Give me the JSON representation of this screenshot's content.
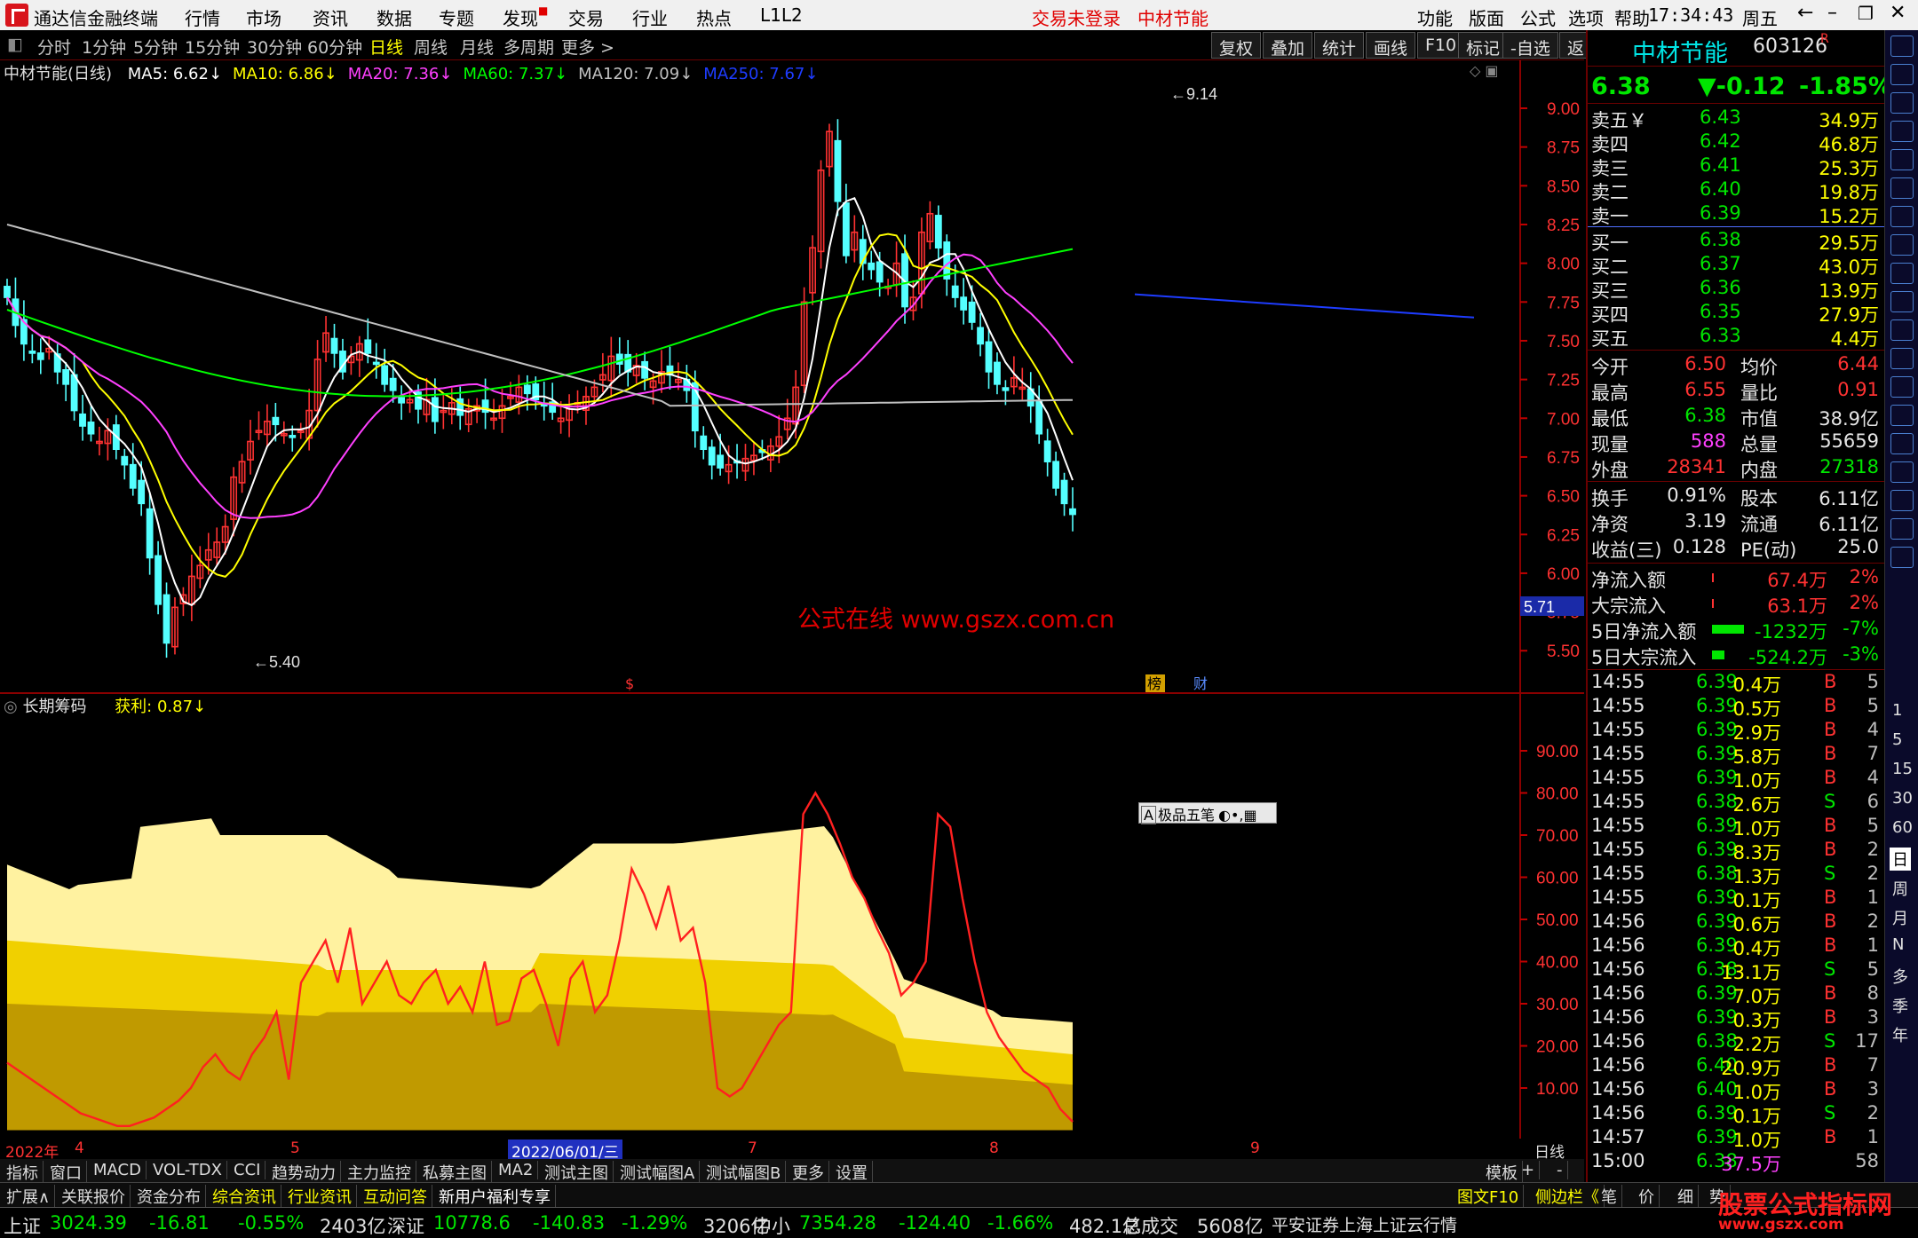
{
  "titlebar": {
    "app_name": "通达信金融终端",
    "menu": [
      "行情",
      "市场",
      "资讯",
      "数据",
      "专题",
      "发现",
      "交易",
      "行业",
      "热点",
      "L1L2"
    ],
    "login_status": "交易未登录",
    "stock_name_title": "中材节能",
    "right_menu": [
      "功能",
      "版面",
      "公式",
      "选项",
      "帮助"
    ],
    "time": "17:34:43",
    "weekday": "周五"
  },
  "toolbar": {
    "periods": [
      "分时",
      "1分钟",
      "5分钟",
      "15分钟",
      "30分钟",
      "60分钟",
      "日线",
      "周线",
      "月线",
      "多周期",
      "更多 >"
    ],
    "selected": "日线",
    "right_buttons": [
      "复权",
      "叠加",
      "统计",
      "画线",
      "F10",
      "标记",
      "-自选",
      "返回"
    ]
  },
  "ma_legend": {
    "title": "中材节能(日线)",
    "items": [
      {
        "text": "MA5: 6.62↓",
        "color": "#ffffff"
      },
      {
        "text": "MA10: 6.86↓",
        "color": "#ffff00"
      },
      {
        "text": "MA20: 7.36↓",
        "color": "#ff40ff"
      },
      {
        "text": "MA60: 7.37↓",
        "color": "#00ff00"
      },
      {
        "text": "MA120: 7.09↓",
        "color": "#c0c0c0"
      },
      {
        "text": "MA250: 7.67↓",
        "color": "#1e3cff"
      }
    ]
  },
  "price_axis": [
    "9.00",
    "8.75",
    "8.50",
    "8.25",
    "8.00",
    "7.75",
    "7.50",
    "7.25",
    "7.00",
    "6.75",
    "6.50",
    "6.25",
    "6.00",
    "5.75",
    "5.50"
  ],
  "price_marker": "5.71",
  "annotations": {
    "high": "9.14",
    "low": "5.40",
    "watermark": "公式在线  www.gszx.com.cn",
    "marker_s": "$",
    "marker_b1": "榜",
    "marker_b2": "财"
  },
  "indicator": {
    "title": "长期筹码",
    "profit_label": "获利: 0.87↓",
    "axis": [
      "90.00",
      "80.00",
      "70.00",
      "60.00",
      "50.00",
      "40.00",
      "30.00",
      "20.00",
      "10.00"
    ],
    "ime_popup": "极品五笔"
  },
  "date_axis": {
    "labels": [
      "2022年",
      "4",
      "5",
      "2022/06/01/三",
      "7",
      "8",
      "9"
    ],
    "period_btn": "日线"
  },
  "tabs1": {
    "items": [
      "指标",
      "窗口",
      "MACD",
      "VOL-TDX",
      "CCI",
      "趋势动力",
      "主力监控",
      "私募主图",
      "MA2",
      "测试主图",
      "测试幅图A",
      "测试幅图B",
      "更多",
      "设置"
    ],
    "right": [
      "模板",
      "+",
      "-"
    ]
  },
  "tabs2": {
    "items": [
      "扩展∧",
      "关联报价",
      "资金分布",
      "综合资讯",
      "行业资讯",
      "互动问答",
      "新用户福利专享"
    ],
    "right": [
      "图文F10",
      "侧边栏《",
      "笔",
      "价",
      "细",
      "势"
    ]
  },
  "statusbar": {
    "items": [
      {
        "name": "上证",
        "value": "3024.39",
        "chg": "-16.81",
        "pct": "-0.55%",
        "amt": "2403亿"
      },
      {
        "name": "深证",
        "value": "10778.6",
        "chg": "-140.83",
        "pct": "-1.29%",
        "amt": "3206亿"
      },
      {
        "name": "中小",
        "value": "7354.28",
        "chg": "-124.40",
        "pct": "-1.66%",
        "amt": "482.1亿"
      }
    ],
    "total_label": "总成交",
    "total_value": "5608亿",
    "broker": "平安证券上海上证云行情"
  },
  "quote": {
    "name": "中材节能",
    "code": "603126",
    "badge": "R",
    "price": "6.38",
    "change": "▼-0.12",
    "pct": "-1.85%",
    "asks": [
      {
        "label": "卖五￥",
        "price": "6.43",
        "vol": "34.9万"
      },
      {
        "label": "卖四",
        "price": "6.42",
        "vol": "46.8万"
      },
      {
        "label": "卖三",
        "price": "6.41",
        "vol": "25.3万"
      },
      {
        "label": "卖二",
        "price": "6.40",
        "vol": "19.8万"
      },
      {
        "label": "卖一",
        "price": "6.39",
        "vol": "15.2万"
      }
    ],
    "bids": [
      {
        "label": "买一",
        "price": "6.38",
        "vol": "29.5万"
      },
      {
        "label": "买二",
        "price": "6.37",
        "vol": "43.0万"
      },
      {
        "label": "买三",
        "price": "6.36",
        "vol": "13.9万"
      },
      {
        "label": "买四",
        "price": "6.35",
        "vol": "27.9万"
      },
      {
        "label": "买五",
        "price": "6.33",
        "vol": "4.4万"
      }
    ],
    "stats1": [
      {
        "l1": "今开",
        "v1": "6.50",
        "c1": "red",
        "l2": "均价",
        "v2": "6.44",
        "c2": "red"
      },
      {
        "l1": "最高",
        "v1": "6.55",
        "c1": "red",
        "l2": "量比",
        "v2": "0.91",
        "c2": "red"
      },
      {
        "l1": "最低",
        "v1": "6.38",
        "c1": "green",
        "l2": "市值",
        "v2": "38.9亿",
        "c2": "white"
      },
      {
        "l1": "现量",
        "v1": "588",
        "c1": "mag",
        "l2": "总量",
        "v2": "55659",
        "c2": "white"
      },
      {
        "l1": "外盘",
        "v1": "28341",
        "c1": "red",
        "l2": "内盘",
        "v2": "27318",
        "c2": "green"
      }
    ],
    "stats2": [
      {
        "l1": "换手",
        "v1": "0.91%",
        "l2": "股本",
        "v2": "6.11亿"
      },
      {
        "l1": "净资",
        "v1": "3.19",
        "l2": "流通",
        "v2": "6.11亿"
      },
      {
        "l1": "收益(三)",
        "v1": "0.128",
        "l2": "PE(动)",
        "v2": "25.0"
      }
    ],
    "flows": [
      {
        "label": "净流入额",
        "val": "67.4万",
        "pct": "2%",
        "color": "red",
        "bar": 2
      },
      {
        "label": "大宗流入",
        "val": "63.1万",
        "pct": "2%",
        "color": "red",
        "bar": 2
      },
      {
        "label": "5日净流入额",
        "val": "-1232万",
        "pct": "-7%",
        "color": "green",
        "bar": 36
      },
      {
        "label": "5日大宗流入",
        "val": "-524.2万",
        "pct": "-3%",
        "color": "green",
        "bar": 14
      }
    ],
    "ticks": [
      {
        "t": "14:55",
        "p": "6.39",
        "v": "0.4万",
        "d": "B",
        "n": "5"
      },
      {
        "t": "14:55",
        "p": "6.39",
        "v": "0.5万",
        "d": "B",
        "n": "5"
      },
      {
        "t": "14:55",
        "p": "6.39",
        "v": "2.9万",
        "d": "B",
        "n": "4"
      },
      {
        "t": "14:55",
        "p": "6.39",
        "v": "5.8万",
        "d": "B",
        "n": "7"
      },
      {
        "t": "14:55",
        "p": "6.39",
        "v": "1.0万",
        "d": "B",
        "n": "4"
      },
      {
        "t": "14:55",
        "p": "6.38",
        "v": "2.6万",
        "d": "S",
        "n": "6"
      },
      {
        "t": "14:55",
        "p": "6.39",
        "v": "1.0万",
        "d": "B",
        "n": "5"
      },
      {
        "t": "14:55",
        "p": "6.39",
        "v": "8.3万",
        "d": "B",
        "n": "2"
      },
      {
        "t": "14:55",
        "p": "6.38",
        "v": "1.3万",
        "d": "S",
        "n": "2"
      },
      {
        "t": "14:55",
        "p": "6.39",
        "v": "0.1万",
        "d": "B",
        "n": "1"
      },
      {
        "t": "14:56",
        "p": "6.39",
        "v": "0.6万",
        "d": "B",
        "n": "2"
      },
      {
        "t": "14:56",
        "p": "6.39",
        "v": "0.4万",
        "d": "B",
        "n": "1"
      },
      {
        "t": "14:56",
        "p": "6.38",
        "v": "13.1万",
        "d": "S",
        "n": "5"
      },
      {
        "t": "14:56",
        "p": "6.39",
        "v": "7.0万",
        "d": "B",
        "n": "8"
      },
      {
        "t": "14:56",
        "p": "6.39",
        "v": "0.3万",
        "d": "B",
        "n": "3"
      },
      {
        "t": "14:56",
        "p": "6.38",
        "v": "2.2万",
        "d": "S",
        "n": "17"
      },
      {
        "t": "14:56",
        "p": "6.40",
        "v": "20.9万",
        "d": "B",
        "n": "7"
      },
      {
        "t": "14:56",
        "p": "6.40",
        "v": "1.0万",
        "d": "B",
        "n": "3"
      },
      {
        "t": "14:56",
        "p": "6.39",
        "v": "0.1万",
        "d": "S",
        "n": "2"
      },
      {
        "t": "14:57",
        "p": "6.39",
        "v": "1.0万",
        "d": "B",
        "n": "1"
      },
      {
        "t": "15:00",
        "p": "6.38",
        "v": "37.5万",
        "d": "",
        "n": "58"
      }
    ]
  },
  "side_tabs": [
    "1",
    "5",
    "15",
    "30",
    "60",
    "日",
    "周",
    "月",
    "N",
    "多",
    "季",
    "年"
  ],
  "corner_watermark": {
    "title": "股票公式指标网",
    "url": "www.gszx.com"
  },
  "chart_data": {
    "type": "candlestick",
    "title": "中材节能(日线)",
    "ylim": [
      5.3,
      9.25
    ],
    "candles_approx": "daily OHLC from ~2022/03 to 2022/09; range 5.40 to 9.14",
    "indicator_ylim": [
      0,
      100
    ]
  }
}
